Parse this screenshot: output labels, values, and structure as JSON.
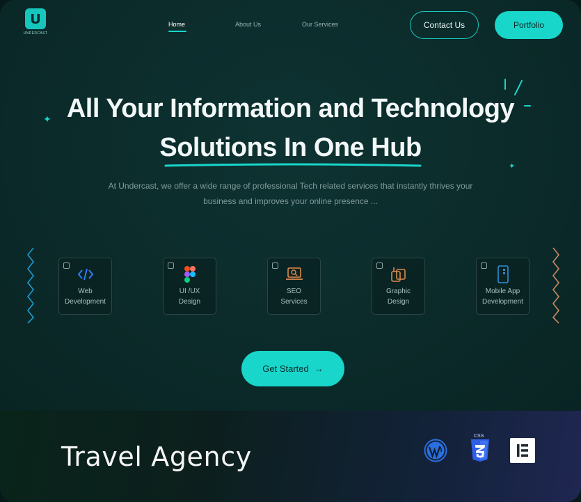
{
  "logo": {
    "text": "UNDERCAST"
  },
  "nav": {
    "items": [
      {
        "label": "Home",
        "active": true
      },
      {
        "label": "About Us",
        "active": false
      },
      {
        "label": "Our Services",
        "active": false
      }
    ],
    "contact_label": "Contact Us",
    "portfolio_label": "Portfolio"
  },
  "hero": {
    "headline_line1": "All Your Information and Technology",
    "headline_line2": "Solutions In One Hub",
    "subtext": "At Undercast, we offer a wide range of professional Tech related services that instantly thrives your business and improves your online presence ..."
  },
  "services": [
    {
      "label_1": "Web",
      "label_2": "Development",
      "icon": "code-icon"
    },
    {
      "label_1": "UI /UX",
      "label_2": "Design",
      "icon": "figma-icon"
    },
    {
      "label_1": "SEO",
      "label_2": "Services",
      "icon": "seo-laptop-icon"
    },
    {
      "label_1": "Graphic",
      "label_2": "Design",
      "icon": "graphic-design-icon"
    },
    {
      "label_1": "Mobile App",
      "label_2": "Development",
      "icon": "mobile-app-icon"
    }
  ],
  "cta": {
    "label": "Get Started",
    "arrow": "→"
  },
  "footer": {
    "title": "Travel Agency",
    "tech_icons": [
      "wordpress-icon",
      "css3-icon",
      "elementor-icon"
    ],
    "css_badge": "CSS"
  },
  "colors": {
    "accent": "#19d6cb",
    "background": "#0b2a29",
    "text": "#f2f7f7",
    "muted": "#7f9b9a"
  }
}
